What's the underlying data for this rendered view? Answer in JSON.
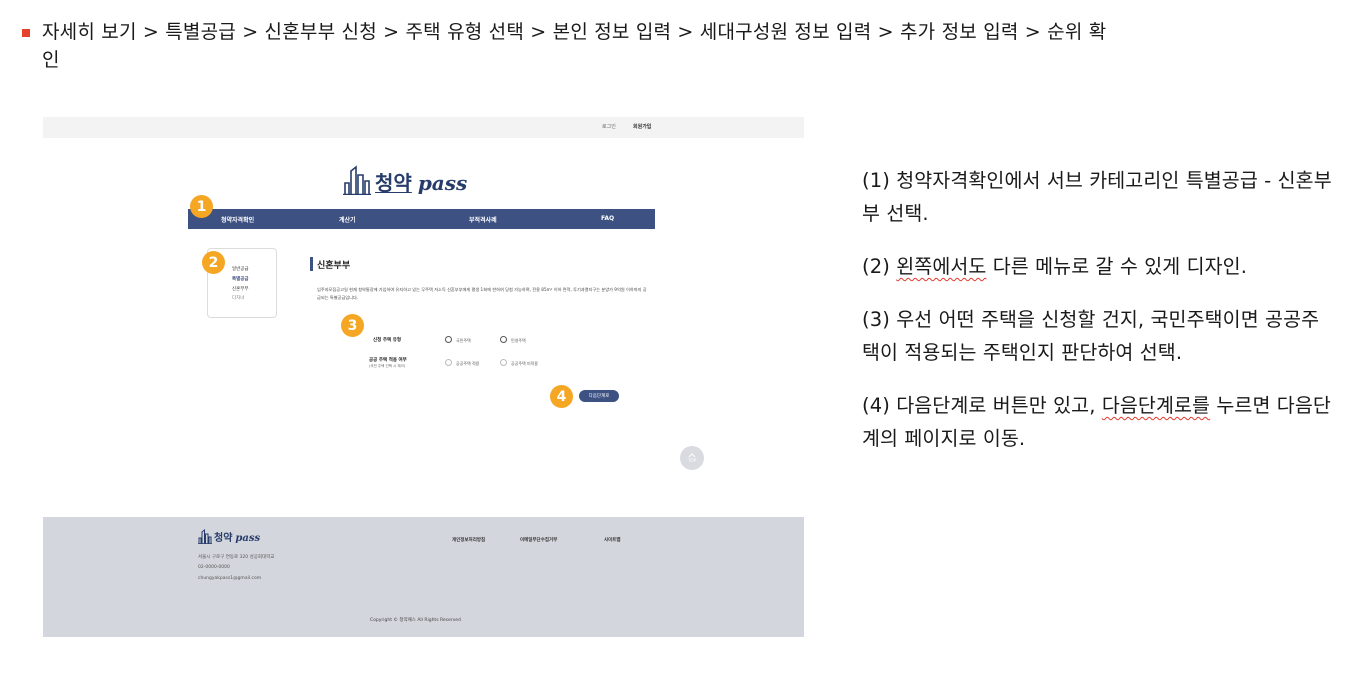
{
  "breadcrumb": {
    "line1": "자세히 보기 > 특별공급 > 신혼부부 신청 > 주택 유형 선택 > 본인 정보 입력 > 세대구성원 정보 입력 > 추가 정보 입력 > 순위 확",
    "line2": "인"
  },
  "mockup": {
    "topbar": {
      "login": "로그인",
      "join": "회원가입"
    },
    "logo": {
      "ko": "청약",
      "en": "pass"
    },
    "nav": [
      "청약자격확인",
      "계산기",
      "부적격사례",
      "FAQ"
    ],
    "badges": [
      "1",
      "2",
      "3",
      "4"
    ],
    "sidebar": [
      "일반공급",
      "특별공급",
      "신혼부부",
      "다자녀"
    ],
    "section_title": "신혼부부",
    "description": "입주자모집공고일 현재 청약통장에 가입하여 유지하고 있는 무주택 저소득 신혼부부에게 평생 1회에 한하여 당첨 가능하며, 전용 85m² 이하 면적, 투기과열지구는 분양가 9억원 이하까지 공급되는 특별공급입니다.",
    "form": {
      "q1_label": "신청 주택 유형",
      "q1_options": [
        "국민주택",
        "민영주택"
      ],
      "q2_label": "공공 주택 적용 여부",
      "q2_sub": "(국민 주택 선택 시 체크)",
      "q2_options": [
        "공공주택 적용",
        "공공주택 미적용"
      ]
    },
    "next_button": "다음단계로",
    "top_button": "TOP",
    "footer": {
      "logo_ko": "청약",
      "logo_en": "pass",
      "address": "서울시 구로구 연동로 320 성공회대학교",
      "phone": "02-0000-0000",
      "email": "chungyakpass1@gmail.com",
      "links": [
        "개인정보처리방침",
        "이메일무단수집거부",
        "사이트맵"
      ],
      "copyright": "Copyright © 청약패스 All Rights Reserved"
    }
  },
  "notes": {
    "n1": "(1) 청약자격확인에서 서브 카테고리인 특별공급 - 신혼부부 선택.",
    "n2_pre": "(2) ",
    "n2_squiggle": "왼쪽에서도",
    "n2_post": " 다른 메뉴로 갈 수 있게 디자인.",
    "n3": "(3) 우선 어떤 주택을 신청할 건지, 국민주택이면 공공주택이 적용되는 주택인지 판단하여 선택.",
    "n4_pre": "(4) 다음단계로 버튼만 있고, ",
    "n4_squiggle": "다음단계로를",
    "n4_post": " 누르면 다음단계의 페이지로 이동."
  },
  "colors": {
    "accent_bullet": "#e8412b",
    "nav_blue": "#3d5182",
    "badge_orange": "#f5a623",
    "footer_gray": "#d3d6dc"
  }
}
